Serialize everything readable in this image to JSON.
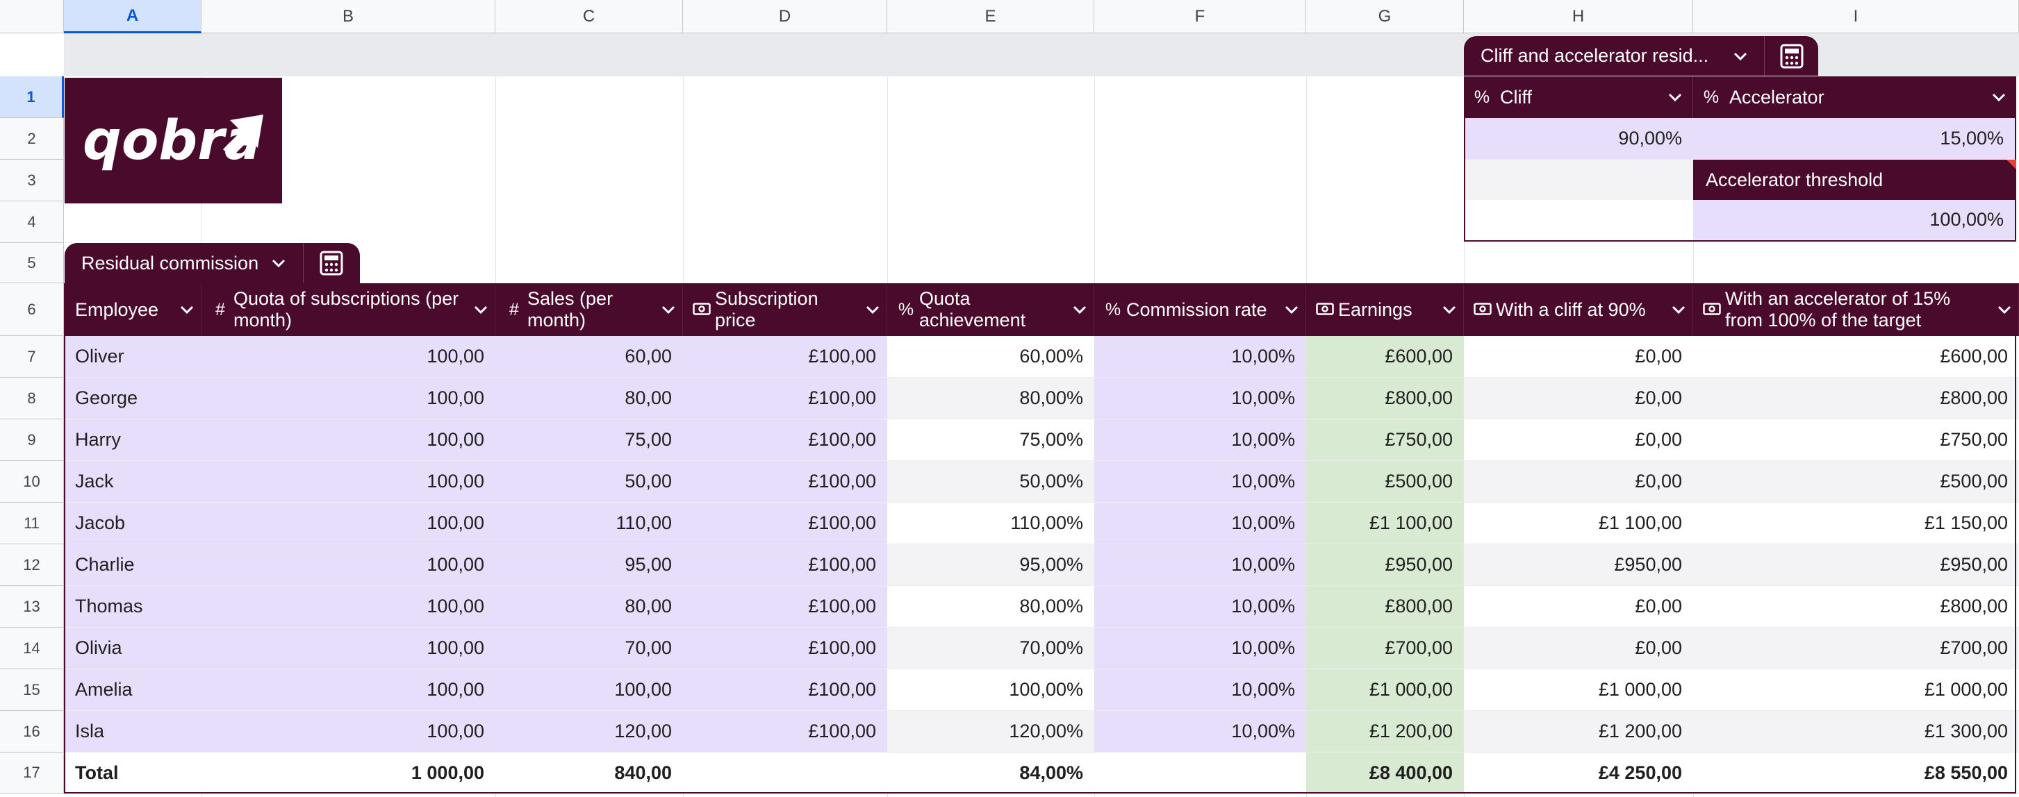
{
  "grid": {
    "columns": [
      "A",
      "B",
      "C",
      "D",
      "E",
      "F",
      "G",
      "H",
      "I"
    ],
    "selected_column": "A",
    "rows": [
      "1",
      "2",
      "3",
      "4",
      "5",
      "6",
      "7",
      "8",
      "9",
      "10",
      "11",
      "12",
      "13",
      "14",
      "15",
      "16",
      "17"
    ],
    "selected_row": "1"
  },
  "logo": {
    "text": "qobra"
  },
  "colors": {
    "brand": "#4a0a2b",
    "input_fill": "#e7defc",
    "earnings_fill": "#d9ead3",
    "stripe": "#f3f3f5"
  },
  "main_table": {
    "tab_label": "Residual commission",
    "headers": [
      {
        "icon": "",
        "label": "Employee"
      },
      {
        "icon": "#",
        "label": "Quota of subscriptions (per month)"
      },
      {
        "icon": "#",
        "label": "Sales (per month)"
      },
      {
        "icon": "money",
        "label": "Subscription price"
      },
      {
        "icon": "%",
        "label": "Quota achievement"
      },
      {
        "icon": "%",
        "label": "Commission rate"
      },
      {
        "icon": "money",
        "label": "Earnings"
      },
      {
        "icon": "money",
        "label": "With a cliff at 90%"
      },
      {
        "icon": "money",
        "label": "With an accelerator of 15% from 100% of the target"
      }
    ],
    "rows": [
      [
        "Oliver",
        "100,00",
        "60,00",
        "£100,00",
        "60,00%",
        "10,00%",
        "£600,00",
        "£0,00",
        "£600,00"
      ],
      [
        "George",
        "100,00",
        "80,00",
        "£100,00",
        "80,00%",
        "10,00%",
        "£800,00",
        "£0,00",
        "£800,00"
      ],
      [
        "Harry",
        "100,00",
        "75,00",
        "£100,00",
        "75,00%",
        "10,00%",
        "£750,00",
        "£0,00",
        "£750,00"
      ],
      [
        "Jack",
        "100,00",
        "50,00",
        "£100,00",
        "50,00%",
        "10,00%",
        "£500,00",
        "£0,00",
        "£500,00"
      ],
      [
        "Jacob",
        "100,00",
        "110,00",
        "£100,00",
        "110,00%",
        "10,00%",
        "£1 100,00",
        "£1 100,00",
        "£1 150,00"
      ],
      [
        "Charlie",
        "100,00",
        "95,00",
        "£100,00",
        "95,00%",
        "10,00%",
        "£950,00",
        "£950,00",
        "£950,00"
      ],
      [
        "Thomas",
        "100,00",
        "80,00",
        "£100,00",
        "80,00%",
        "10,00%",
        "£800,00",
        "£0,00",
        "£800,00"
      ],
      [
        "Olivia",
        "100,00",
        "70,00",
        "£100,00",
        "70,00%",
        "10,00%",
        "£700,00",
        "£0,00",
        "£700,00"
      ],
      [
        "Amelia",
        "100,00",
        "100,00",
        "£100,00",
        "100,00%",
        "10,00%",
        "£1 000,00",
        "£1 000,00",
        "£1 000,00"
      ],
      [
        "Isla",
        "100,00",
        "120,00",
        "£100,00",
        "120,00%",
        "10,00%",
        "£1 200,00",
        "£1 200,00",
        "£1 300,00"
      ]
    ],
    "total": [
      "Total",
      "1 000,00",
      "840,00",
      "",
      "84,00%",
      "",
      "£8 400,00",
      "£4 250,00",
      "£8 550,00"
    ]
  },
  "param_table": {
    "tab_label": "Cliff and accelerator resid...",
    "cliff_label": "Cliff",
    "cliff_value": "90,00%",
    "accelerator_label": "Accelerator",
    "accelerator_value": "15,00%",
    "threshold_label": "Accelerator threshold",
    "threshold_value": "100,00%"
  }
}
